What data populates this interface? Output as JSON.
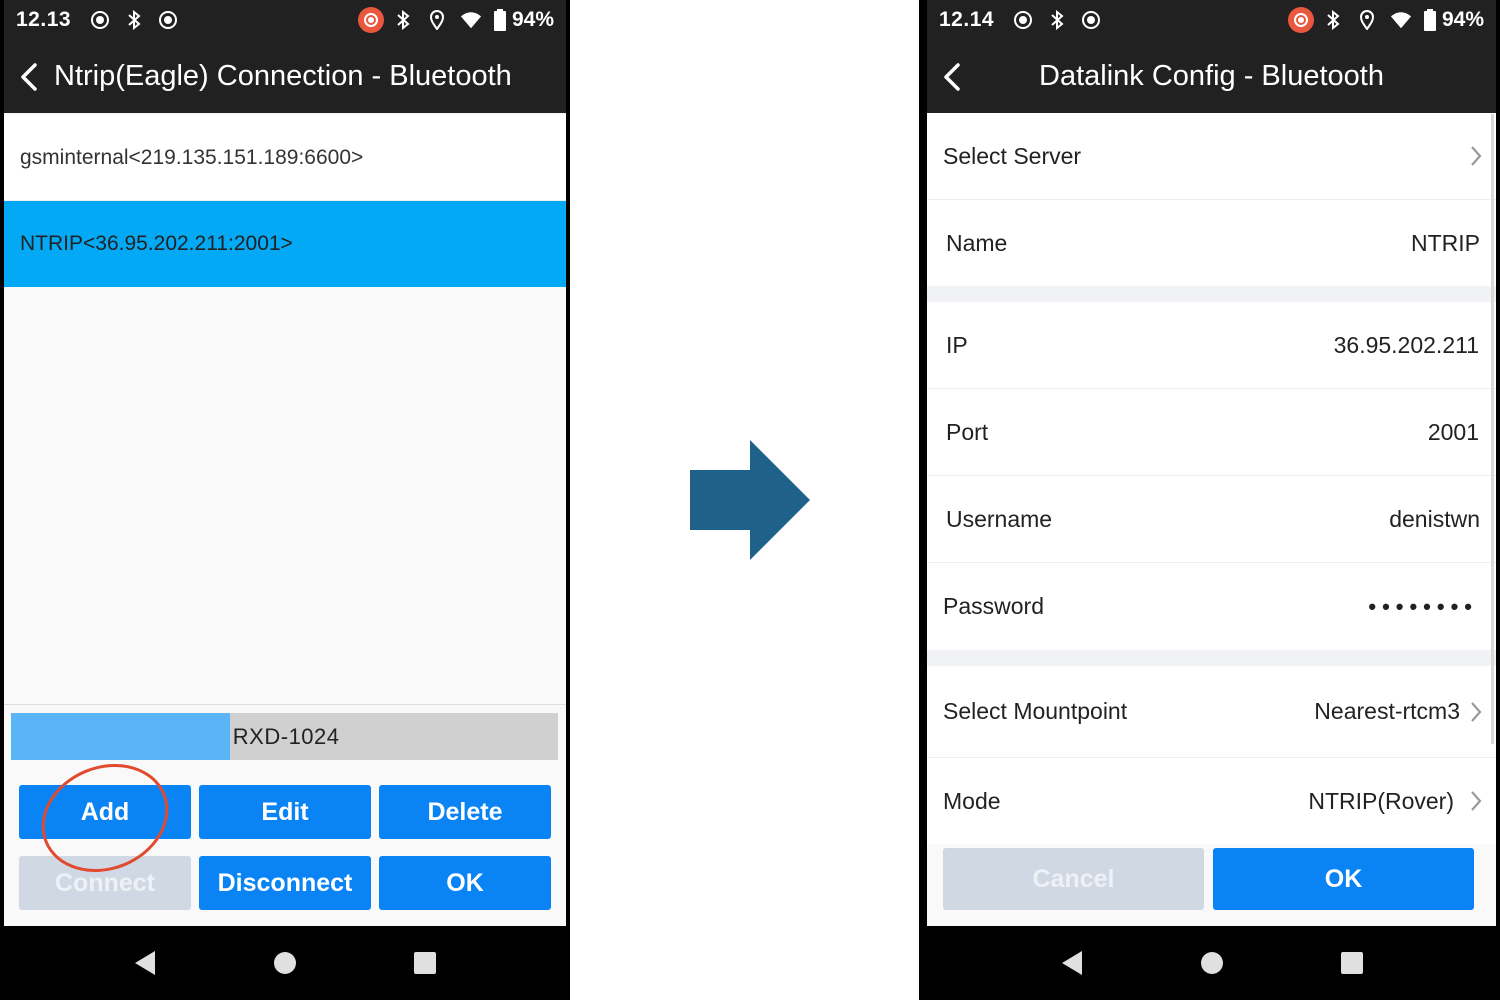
{
  "left_screen": {
    "status": {
      "time": "12.13",
      "battery": "94%"
    },
    "title": "Ntrip(Eagle) Connection - Bluetooth",
    "connections": [
      {
        "label": "gsminternal<219.135.151.189:6600>",
        "selected": false
      },
      {
        "label": "NTRIP<36.95.202.211:2001>",
        "selected": true
      }
    ],
    "progress": {
      "label": "RXD-1024",
      "fill_fraction": 0.4
    },
    "buttons": {
      "add": "Add",
      "edit": "Edit",
      "delete": "Delete",
      "connect": "Connect",
      "disconnect": "Disconnect",
      "ok": "OK"
    },
    "annotation": {
      "highlighted_button": "Add",
      "color": "#e24a30"
    }
  },
  "arrow": {
    "color": "#1f6188",
    "direction": "right"
  },
  "right_screen": {
    "status": {
      "time": "12.14",
      "battery": "94%"
    },
    "title": "Datalink Config - Bluetooth",
    "fields": {
      "select_server": {
        "label": "Select Server",
        "value": ""
      },
      "name": {
        "label": "Name",
        "value": "NTRIP"
      },
      "ip": {
        "label": "IP",
        "value": "36.95.202.211"
      },
      "port": {
        "label": "Port",
        "value": "2001"
      },
      "username": {
        "label": "Username",
        "value": "denistwn"
      },
      "password": {
        "label": "Password",
        "value": "••••••••"
      },
      "mountpoint": {
        "label": "Select Mountpoint",
        "value": "Nearest-rtcm3"
      },
      "mode": {
        "label": "Mode",
        "value": "NTRIP(Rover)"
      }
    },
    "buttons": {
      "cancel": "Cancel",
      "ok": "OK"
    }
  },
  "colors": {
    "accent": "#0a84f5",
    "selected_row": "#03a9f4",
    "bar": "#212121",
    "disabled": "#cfd8e3"
  }
}
